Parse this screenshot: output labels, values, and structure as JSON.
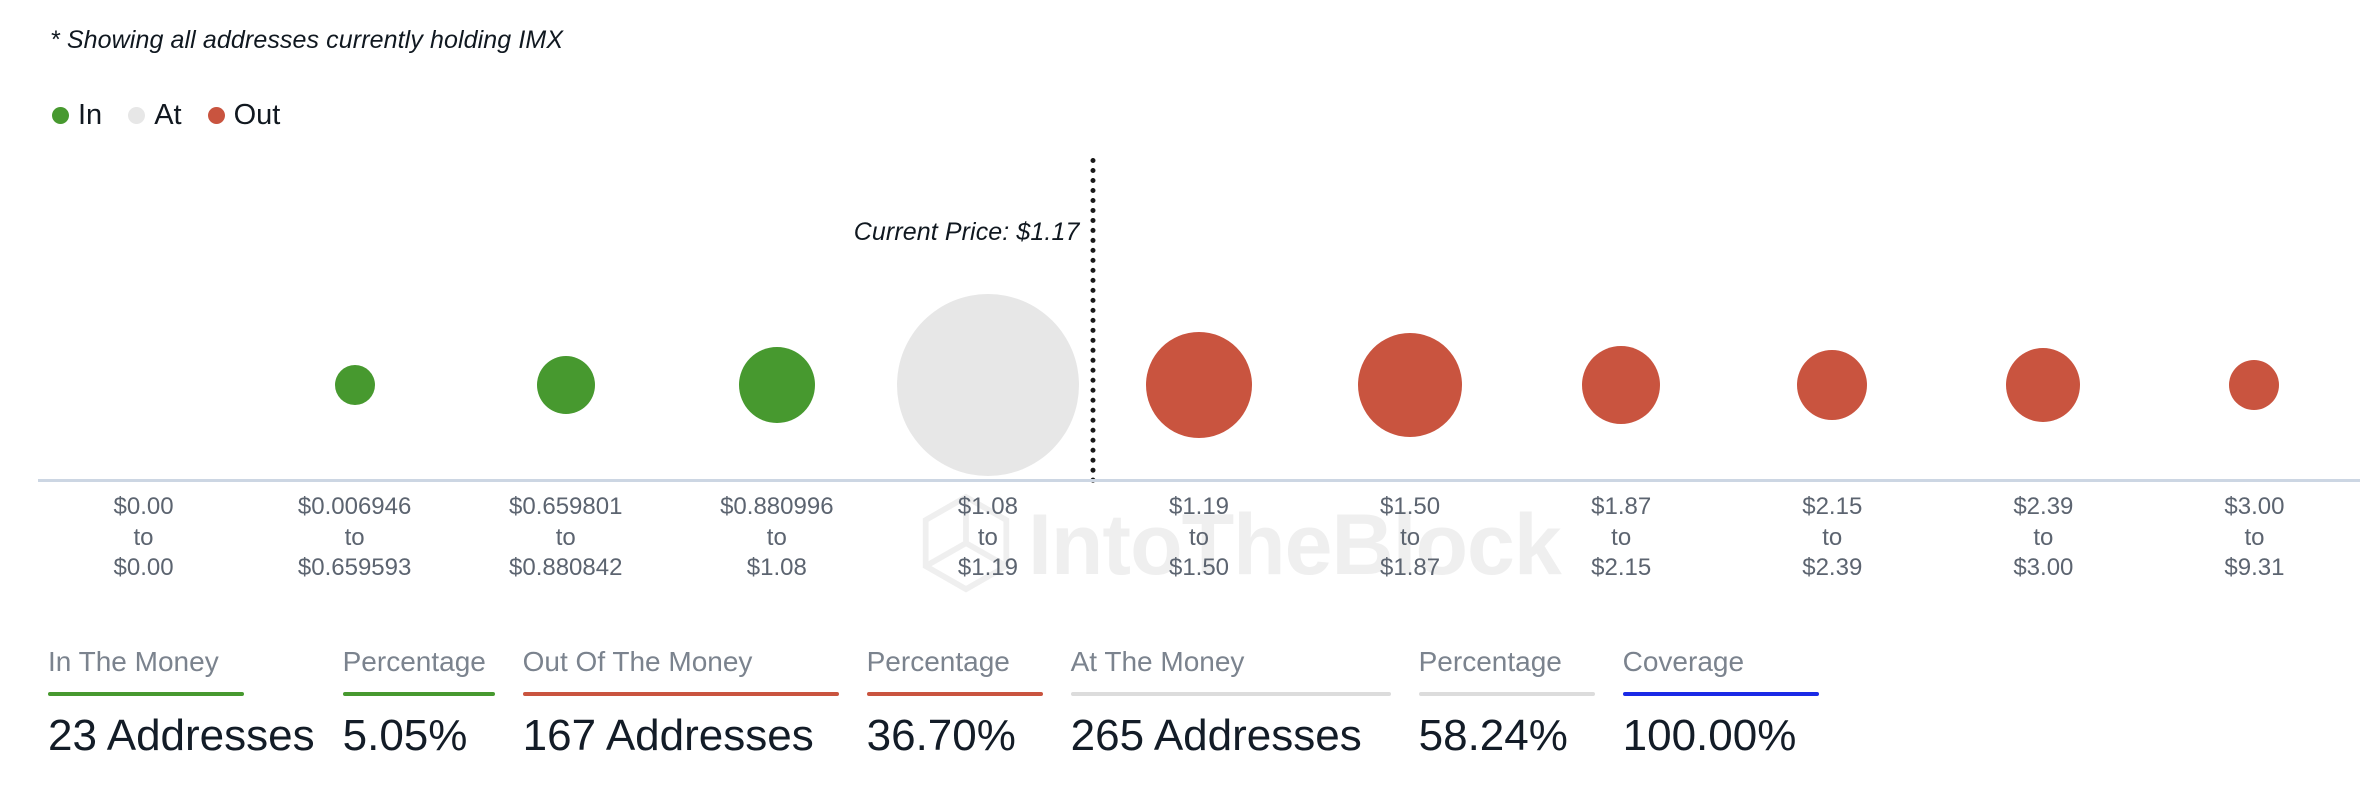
{
  "footnote": "* Showing all addresses currently holding IMX",
  "watermark": {
    "text": "IntoTheBlock",
    "logo_icon": "cube-logo-icon"
  },
  "legend": {
    "items": [
      {
        "label": "In",
        "color": "#47992f",
        "icon": "legend-dot-in"
      },
      {
        "label": "At",
        "color": "#e7e7e7",
        "icon": "legend-dot-at"
      },
      {
        "label": "Out",
        "color": "#c9543f",
        "icon": "legend-dot-out"
      }
    ]
  },
  "chart_data": {
    "type": "scatter",
    "title": "",
    "subtitle": "* Showing all addresses currently holding IMX",
    "xlabel": "",
    "ylabel": "",
    "grid": false,
    "legend_position": "top-left",
    "current_price": {
      "label": "Current Price: $1.17",
      "value": 1.17,
      "bin_index": 4
    },
    "colors": {
      "in": "#47992f",
      "at": "#e7e7e7",
      "out": "#c9543f"
    },
    "categories": [
      "$0.00 to $0.00",
      "$0.006946 to $0.659593",
      "$0.659801 to $0.880842",
      "$0.880996 to $1.08",
      "$1.08 to $1.19",
      "$1.19 to $1.50",
      "$1.50 to $1.87",
      "$1.87 to $2.15",
      "$2.15 to $2.39",
      "$2.39 to $3.00",
      "$3.00 to $9.31"
    ],
    "tick_labels": [
      {
        "from": "$0.00",
        "to": "$0.00"
      },
      {
        "from": "$0.006946",
        "to": "$0.659593"
      },
      {
        "from": "$0.659801",
        "to": "$0.880842"
      },
      {
        "from": "$0.880996",
        "to": "$1.08"
      },
      {
        "from": "$1.08",
        "to": "$1.19"
      },
      {
        "from": "$1.19",
        "to": "$1.50"
      },
      {
        "from": "$1.50",
        "to": "$1.87"
      },
      {
        "from": "$1.87",
        "to": "$2.15"
      },
      {
        "from": "$2.15",
        "to": "$2.39"
      },
      {
        "from": "$2.39",
        "to": "$3.00"
      },
      {
        "from": "$3.00",
        "to": "$9.31"
      }
    ],
    "points": [
      {
        "bin": "$0.00 to $0.00",
        "state": "in",
        "size": 0
      },
      {
        "bin": "$0.006946 to $0.659593",
        "state": "in",
        "size": 40
      },
      {
        "bin": "$0.659801 to $0.880842",
        "state": "in",
        "size": 58
      },
      {
        "bin": "$0.880996 to $1.08",
        "state": "in",
        "size": 76
      },
      {
        "bin": "$1.08 to $1.19",
        "state": "at",
        "size": 182
      },
      {
        "bin": "$1.19 to $1.50",
        "state": "out",
        "size": 106
      },
      {
        "bin": "$1.50 to $1.87",
        "state": "out",
        "size": 104
      },
      {
        "bin": "$1.87 to $2.15",
        "state": "out",
        "size": 78
      },
      {
        "bin": "$2.15 to $2.39",
        "state": "out",
        "size": 70
      },
      {
        "bin": "$2.39 to $3.00",
        "state": "out",
        "size": 74
      },
      {
        "bin": "$3.00 to $9.31",
        "state": "out",
        "size": 50
      }
    ]
  },
  "stats": [
    {
      "label": "In The Money",
      "value": "23 Addresses",
      "rule_color": "#47992f",
      "rule_width": 196
    },
    {
      "label": "Percentage",
      "value": "5.05%",
      "rule_color": "#47992f",
      "rule_width": 152
    },
    {
      "label": "Out Of The Money",
      "value": "167 Addresses",
      "rule_color": "#c9543f",
      "rule_width": 316
    },
    {
      "label": "Percentage",
      "value": "36.70%",
      "rule_color": "#c9543f",
      "rule_width": 176
    },
    {
      "label": "At The Money",
      "value": "265 Addresses",
      "rule_color": "#dcdcdc",
      "rule_width": 320
    },
    {
      "label": "Percentage",
      "value": "58.24%",
      "rule_color": "#dcdcdc",
      "rule_width": 176
    },
    {
      "label": "Coverage",
      "value": "100.00%",
      "rule_color": "#1a2ae6",
      "rule_width": 196
    }
  ]
}
